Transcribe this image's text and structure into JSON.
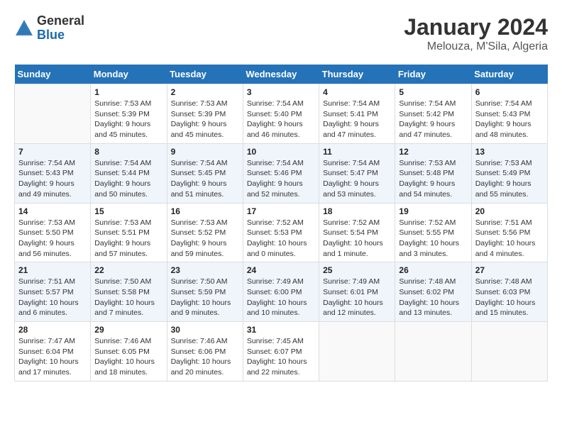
{
  "header": {
    "logo_general": "General",
    "logo_blue": "Blue",
    "month_title": "January 2024",
    "location": "Melouza, M'Sila, Algeria"
  },
  "calendar": {
    "weekdays": [
      "Sunday",
      "Monday",
      "Tuesday",
      "Wednesday",
      "Thursday",
      "Friday",
      "Saturday"
    ],
    "weeks": [
      [
        {
          "day": "",
          "info": ""
        },
        {
          "day": "1",
          "info": "Sunrise: 7:53 AM\nSunset: 5:39 PM\nDaylight: 9 hours\nand 45 minutes."
        },
        {
          "day": "2",
          "info": "Sunrise: 7:53 AM\nSunset: 5:39 PM\nDaylight: 9 hours\nand 45 minutes."
        },
        {
          "day": "3",
          "info": "Sunrise: 7:54 AM\nSunset: 5:40 PM\nDaylight: 9 hours\nand 46 minutes."
        },
        {
          "day": "4",
          "info": "Sunrise: 7:54 AM\nSunset: 5:41 PM\nDaylight: 9 hours\nand 47 minutes."
        },
        {
          "day": "5",
          "info": "Sunrise: 7:54 AM\nSunset: 5:42 PM\nDaylight: 9 hours\nand 47 minutes."
        },
        {
          "day": "6",
          "info": "Sunrise: 7:54 AM\nSunset: 5:43 PM\nDaylight: 9 hours\nand 48 minutes."
        }
      ],
      [
        {
          "day": "7",
          "info": "Sunrise: 7:54 AM\nSunset: 5:43 PM\nDaylight: 9 hours\nand 49 minutes."
        },
        {
          "day": "8",
          "info": "Sunrise: 7:54 AM\nSunset: 5:44 PM\nDaylight: 9 hours\nand 50 minutes."
        },
        {
          "day": "9",
          "info": "Sunrise: 7:54 AM\nSunset: 5:45 PM\nDaylight: 9 hours\nand 51 minutes."
        },
        {
          "day": "10",
          "info": "Sunrise: 7:54 AM\nSunset: 5:46 PM\nDaylight: 9 hours\nand 52 minutes."
        },
        {
          "day": "11",
          "info": "Sunrise: 7:54 AM\nSunset: 5:47 PM\nDaylight: 9 hours\nand 53 minutes."
        },
        {
          "day": "12",
          "info": "Sunrise: 7:53 AM\nSunset: 5:48 PM\nDaylight: 9 hours\nand 54 minutes."
        },
        {
          "day": "13",
          "info": "Sunrise: 7:53 AM\nSunset: 5:49 PM\nDaylight: 9 hours\nand 55 minutes."
        }
      ],
      [
        {
          "day": "14",
          "info": "Sunrise: 7:53 AM\nSunset: 5:50 PM\nDaylight: 9 hours\nand 56 minutes."
        },
        {
          "day": "15",
          "info": "Sunrise: 7:53 AM\nSunset: 5:51 PM\nDaylight: 9 hours\nand 57 minutes."
        },
        {
          "day": "16",
          "info": "Sunrise: 7:53 AM\nSunset: 5:52 PM\nDaylight: 9 hours\nand 59 minutes."
        },
        {
          "day": "17",
          "info": "Sunrise: 7:52 AM\nSunset: 5:53 PM\nDaylight: 10 hours\nand 0 minutes."
        },
        {
          "day": "18",
          "info": "Sunrise: 7:52 AM\nSunset: 5:54 PM\nDaylight: 10 hours\nand 1 minute."
        },
        {
          "day": "19",
          "info": "Sunrise: 7:52 AM\nSunset: 5:55 PM\nDaylight: 10 hours\nand 3 minutes."
        },
        {
          "day": "20",
          "info": "Sunrise: 7:51 AM\nSunset: 5:56 PM\nDaylight: 10 hours\nand 4 minutes."
        }
      ],
      [
        {
          "day": "21",
          "info": "Sunrise: 7:51 AM\nSunset: 5:57 PM\nDaylight: 10 hours\nand 6 minutes."
        },
        {
          "day": "22",
          "info": "Sunrise: 7:50 AM\nSunset: 5:58 PM\nDaylight: 10 hours\nand 7 minutes."
        },
        {
          "day": "23",
          "info": "Sunrise: 7:50 AM\nSunset: 5:59 PM\nDaylight: 10 hours\nand 9 minutes."
        },
        {
          "day": "24",
          "info": "Sunrise: 7:49 AM\nSunset: 6:00 PM\nDaylight: 10 hours\nand 10 minutes."
        },
        {
          "day": "25",
          "info": "Sunrise: 7:49 AM\nSunset: 6:01 PM\nDaylight: 10 hours\nand 12 minutes."
        },
        {
          "day": "26",
          "info": "Sunrise: 7:48 AM\nSunset: 6:02 PM\nDaylight: 10 hours\nand 13 minutes."
        },
        {
          "day": "27",
          "info": "Sunrise: 7:48 AM\nSunset: 6:03 PM\nDaylight: 10 hours\nand 15 minutes."
        }
      ],
      [
        {
          "day": "28",
          "info": "Sunrise: 7:47 AM\nSunset: 6:04 PM\nDaylight: 10 hours\nand 17 minutes."
        },
        {
          "day": "29",
          "info": "Sunrise: 7:46 AM\nSunset: 6:05 PM\nDaylight: 10 hours\nand 18 minutes."
        },
        {
          "day": "30",
          "info": "Sunrise: 7:46 AM\nSunset: 6:06 PM\nDaylight: 10 hours\nand 20 minutes."
        },
        {
          "day": "31",
          "info": "Sunrise: 7:45 AM\nSunset: 6:07 PM\nDaylight: 10 hours\nand 22 minutes."
        },
        {
          "day": "",
          "info": ""
        },
        {
          "day": "",
          "info": ""
        },
        {
          "day": "",
          "info": ""
        }
      ]
    ]
  }
}
